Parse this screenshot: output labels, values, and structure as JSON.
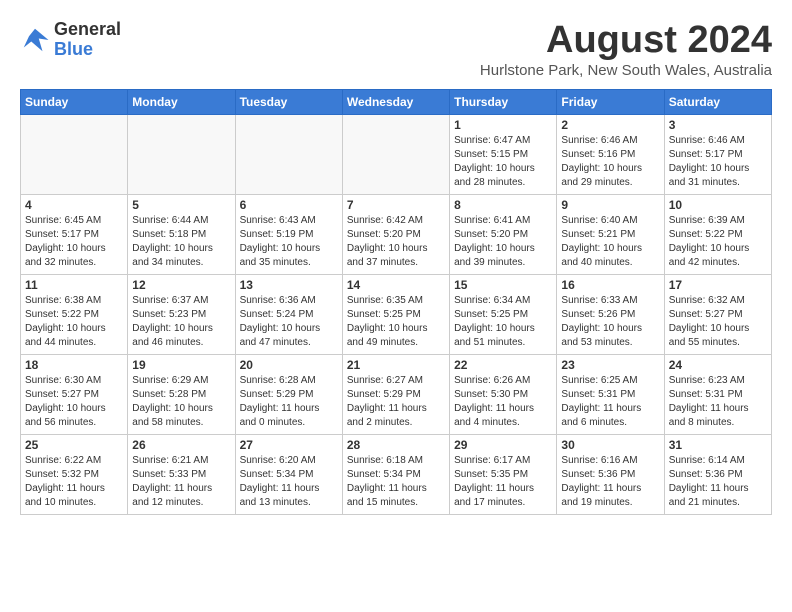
{
  "logo": {
    "general": "General",
    "blue": "Blue"
  },
  "title": "August 2024",
  "location": "Hurlstone Park, New South Wales, Australia",
  "days_of_week": [
    "Sunday",
    "Monday",
    "Tuesday",
    "Wednesday",
    "Thursday",
    "Friday",
    "Saturday"
  ],
  "weeks": [
    [
      {
        "day": "",
        "info": ""
      },
      {
        "day": "",
        "info": ""
      },
      {
        "day": "",
        "info": ""
      },
      {
        "day": "",
        "info": ""
      },
      {
        "day": "1",
        "info": "Sunrise: 6:47 AM\nSunset: 5:15 PM\nDaylight: 10 hours\nand 28 minutes."
      },
      {
        "day": "2",
        "info": "Sunrise: 6:46 AM\nSunset: 5:16 PM\nDaylight: 10 hours\nand 29 minutes."
      },
      {
        "day": "3",
        "info": "Sunrise: 6:46 AM\nSunset: 5:17 PM\nDaylight: 10 hours\nand 31 minutes."
      }
    ],
    [
      {
        "day": "4",
        "info": "Sunrise: 6:45 AM\nSunset: 5:17 PM\nDaylight: 10 hours\nand 32 minutes."
      },
      {
        "day": "5",
        "info": "Sunrise: 6:44 AM\nSunset: 5:18 PM\nDaylight: 10 hours\nand 34 minutes."
      },
      {
        "day": "6",
        "info": "Sunrise: 6:43 AM\nSunset: 5:19 PM\nDaylight: 10 hours\nand 35 minutes."
      },
      {
        "day": "7",
        "info": "Sunrise: 6:42 AM\nSunset: 5:20 PM\nDaylight: 10 hours\nand 37 minutes."
      },
      {
        "day": "8",
        "info": "Sunrise: 6:41 AM\nSunset: 5:20 PM\nDaylight: 10 hours\nand 39 minutes."
      },
      {
        "day": "9",
        "info": "Sunrise: 6:40 AM\nSunset: 5:21 PM\nDaylight: 10 hours\nand 40 minutes."
      },
      {
        "day": "10",
        "info": "Sunrise: 6:39 AM\nSunset: 5:22 PM\nDaylight: 10 hours\nand 42 minutes."
      }
    ],
    [
      {
        "day": "11",
        "info": "Sunrise: 6:38 AM\nSunset: 5:22 PM\nDaylight: 10 hours\nand 44 minutes."
      },
      {
        "day": "12",
        "info": "Sunrise: 6:37 AM\nSunset: 5:23 PM\nDaylight: 10 hours\nand 46 minutes."
      },
      {
        "day": "13",
        "info": "Sunrise: 6:36 AM\nSunset: 5:24 PM\nDaylight: 10 hours\nand 47 minutes."
      },
      {
        "day": "14",
        "info": "Sunrise: 6:35 AM\nSunset: 5:25 PM\nDaylight: 10 hours\nand 49 minutes."
      },
      {
        "day": "15",
        "info": "Sunrise: 6:34 AM\nSunset: 5:25 PM\nDaylight: 10 hours\nand 51 minutes."
      },
      {
        "day": "16",
        "info": "Sunrise: 6:33 AM\nSunset: 5:26 PM\nDaylight: 10 hours\nand 53 minutes."
      },
      {
        "day": "17",
        "info": "Sunrise: 6:32 AM\nSunset: 5:27 PM\nDaylight: 10 hours\nand 55 minutes."
      }
    ],
    [
      {
        "day": "18",
        "info": "Sunrise: 6:30 AM\nSunset: 5:27 PM\nDaylight: 10 hours\nand 56 minutes."
      },
      {
        "day": "19",
        "info": "Sunrise: 6:29 AM\nSunset: 5:28 PM\nDaylight: 10 hours\nand 58 minutes."
      },
      {
        "day": "20",
        "info": "Sunrise: 6:28 AM\nSunset: 5:29 PM\nDaylight: 11 hours\nand 0 minutes."
      },
      {
        "day": "21",
        "info": "Sunrise: 6:27 AM\nSunset: 5:29 PM\nDaylight: 11 hours\nand 2 minutes."
      },
      {
        "day": "22",
        "info": "Sunrise: 6:26 AM\nSunset: 5:30 PM\nDaylight: 11 hours\nand 4 minutes."
      },
      {
        "day": "23",
        "info": "Sunrise: 6:25 AM\nSunset: 5:31 PM\nDaylight: 11 hours\nand 6 minutes."
      },
      {
        "day": "24",
        "info": "Sunrise: 6:23 AM\nSunset: 5:31 PM\nDaylight: 11 hours\nand 8 minutes."
      }
    ],
    [
      {
        "day": "25",
        "info": "Sunrise: 6:22 AM\nSunset: 5:32 PM\nDaylight: 11 hours\nand 10 minutes."
      },
      {
        "day": "26",
        "info": "Sunrise: 6:21 AM\nSunset: 5:33 PM\nDaylight: 11 hours\nand 12 minutes."
      },
      {
        "day": "27",
        "info": "Sunrise: 6:20 AM\nSunset: 5:34 PM\nDaylight: 11 hours\nand 13 minutes."
      },
      {
        "day": "28",
        "info": "Sunrise: 6:18 AM\nSunset: 5:34 PM\nDaylight: 11 hours\nand 15 minutes."
      },
      {
        "day": "29",
        "info": "Sunrise: 6:17 AM\nSunset: 5:35 PM\nDaylight: 11 hours\nand 17 minutes."
      },
      {
        "day": "30",
        "info": "Sunrise: 6:16 AM\nSunset: 5:36 PM\nDaylight: 11 hours\nand 19 minutes."
      },
      {
        "day": "31",
        "info": "Sunrise: 6:14 AM\nSunset: 5:36 PM\nDaylight: 11 hours\nand 21 minutes."
      }
    ]
  ]
}
